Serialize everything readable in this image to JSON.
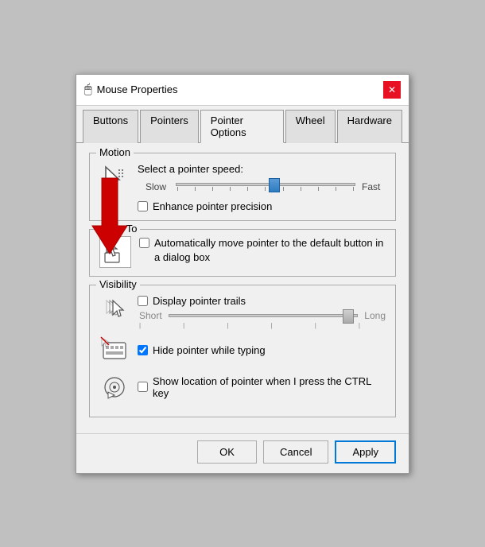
{
  "window": {
    "title": "Mouse Properties",
    "close_label": "✕"
  },
  "tabs": [
    {
      "label": "Buttons",
      "active": false
    },
    {
      "label": "Pointers",
      "active": false
    },
    {
      "label": "Pointer Options",
      "active": true
    },
    {
      "label": "Wheel",
      "active": false
    },
    {
      "label": "Hardware",
      "active": false
    }
  ],
  "motion_group": {
    "label": "Motion",
    "speed_label": "Select a pointer speed:",
    "slow_label": "Slow",
    "fast_label": "Fast",
    "precision_label": "Enhance pointer precision",
    "precision_checked": false
  },
  "snap_group": {
    "label": "Snap To",
    "description": "Automatically move pointer to the default button in a dialog box",
    "checked": false
  },
  "visibility_group": {
    "label": "Visibility",
    "trails_label": "Display pointer trails",
    "trails_checked": false,
    "short_label": "Short",
    "long_label": "Long",
    "hide_label": "Hide pointer while typing",
    "hide_checked": true,
    "ctrl_label": "Show location of pointer when I press the CTRL key",
    "ctrl_checked": false
  },
  "footer": {
    "ok_label": "OK",
    "cancel_label": "Cancel",
    "apply_label": "Apply"
  }
}
